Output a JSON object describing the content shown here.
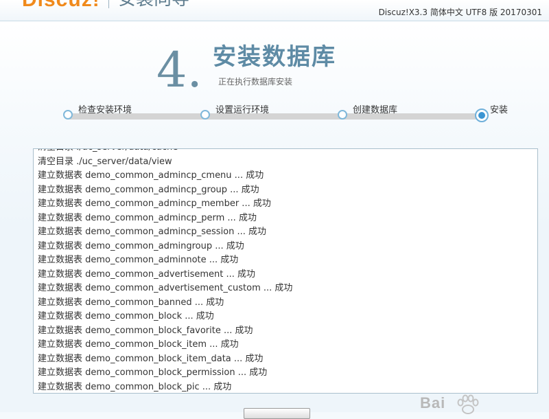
{
  "header": {
    "logo_text": "Discuz!",
    "logo_subtitle": "安装向导",
    "version": "Discuz!X3.3 简体中文 UTF8 版 20170301"
  },
  "step": {
    "number": "4.",
    "title": "安装数据库",
    "subtitle": "正在执行数据库安装"
  },
  "progress": {
    "steps": [
      {
        "label": "检查安装环境",
        "state": "done"
      },
      {
        "label": "设置运行环境",
        "state": "done"
      },
      {
        "label": "创建数据库",
        "state": "done"
      },
      {
        "label": "安装",
        "state": "current"
      }
    ]
  },
  "log": {
    "lines": [
      "清空目录 ./uc_server/data/cache",
      "清空目录 ./uc_server/data/view",
      "建立数据表 demo_common_admincp_cmenu ... 成功",
      "建立数据表 demo_common_admincp_group ... 成功",
      "建立数据表 demo_common_admincp_member ... 成功",
      "建立数据表 demo_common_admincp_perm ... 成功",
      "建立数据表 demo_common_admincp_session ... 成功",
      "建立数据表 demo_common_admingroup ... 成功",
      "建立数据表 demo_common_adminnote ... 成功",
      "建立数据表 demo_common_advertisement ... 成功",
      "建立数据表 demo_common_advertisement_custom ... 成功",
      "建立数据表 demo_common_banned ... 成功",
      "建立数据表 demo_common_block ... 成功",
      "建立数据表 demo_common_block_favorite ... 成功",
      "建立数据表 demo_common_block_item ... 成功",
      "建立数据表 demo_common_block_item_data ... 成功",
      "建立数据表 demo_common_block_permission ... 成功",
      "建立数据表 demo_common_block_pic ... 成功"
    ]
  },
  "watermark": {
    "text": "Bai"
  }
}
